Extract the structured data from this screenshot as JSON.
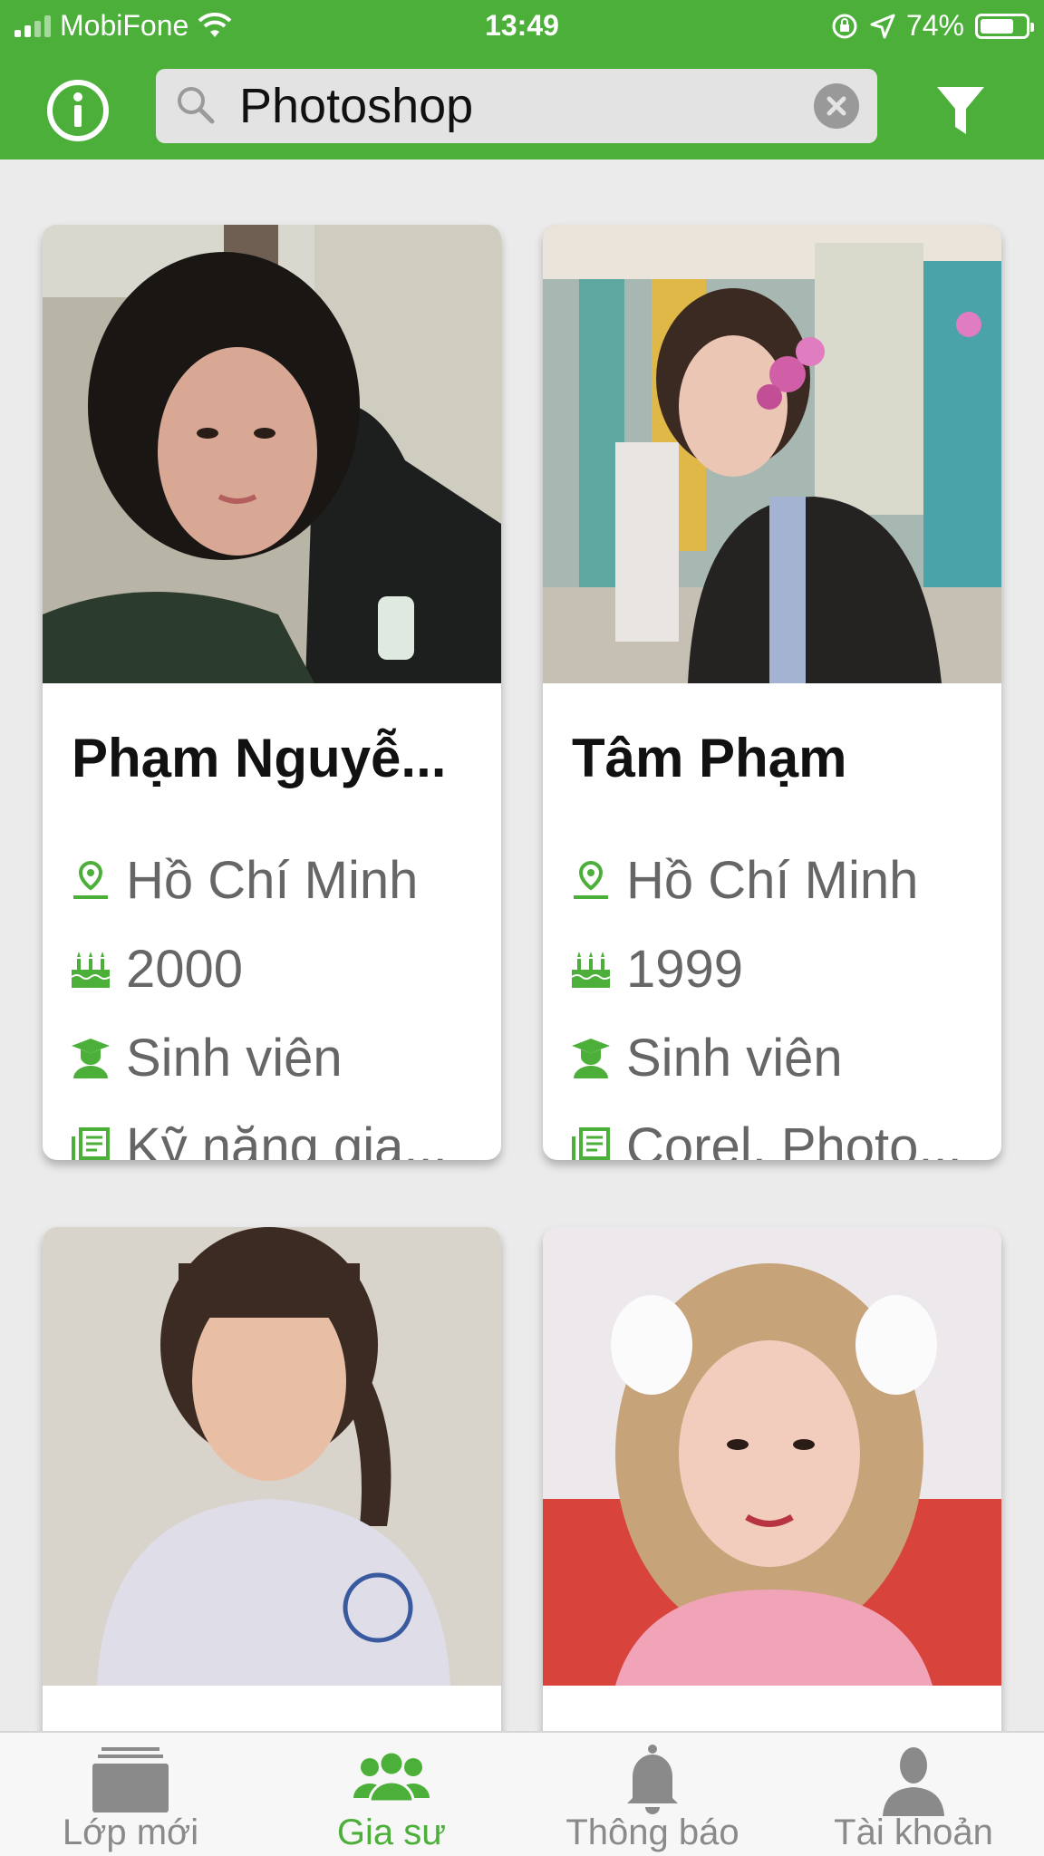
{
  "status_bar": {
    "carrier": "MobiFone",
    "time": "13:49",
    "battery": "74%",
    "battery_level": 0.74
  },
  "search": {
    "value": "Photoshop",
    "placeholder": ""
  },
  "tutors": [
    {
      "name": "Phạm Nguyễ...",
      "location": "Hồ Chí Minh",
      "birth_year": "2000",
      "occupation": "Sinh viên",
      "subjects": "Kỹ năng gia..."
    },
    {
      "name": "Tâm Phạm",
      "location": "Hồ Chí Minh",
      "birth_year": "1999",
      "occupation": "Sinh viên",
      "subjects": "Corel, Photo..."
    },
    {},
    {}
  ],
  "tabs": [
    {
      "label": "Lớp mới",
      "icon": "new-class-icon",
      "active": false
    },
    {
      "label": "Gia sư",
      "icon": "tutors-icon",
      "active": true
    },
    {
      "label": "Thông báo",
      "icon": "bell-icon",
      "active": false
    },
    {
      "label": "Tài khoản",
      "icon": "account-icon",
      "active": false
    }
  ],
  "colors": {
    "accent": "#4caf3a",
    "tab_inactive": "#8a8a8a",
    "text_secondary": "#666666"
  }
}
